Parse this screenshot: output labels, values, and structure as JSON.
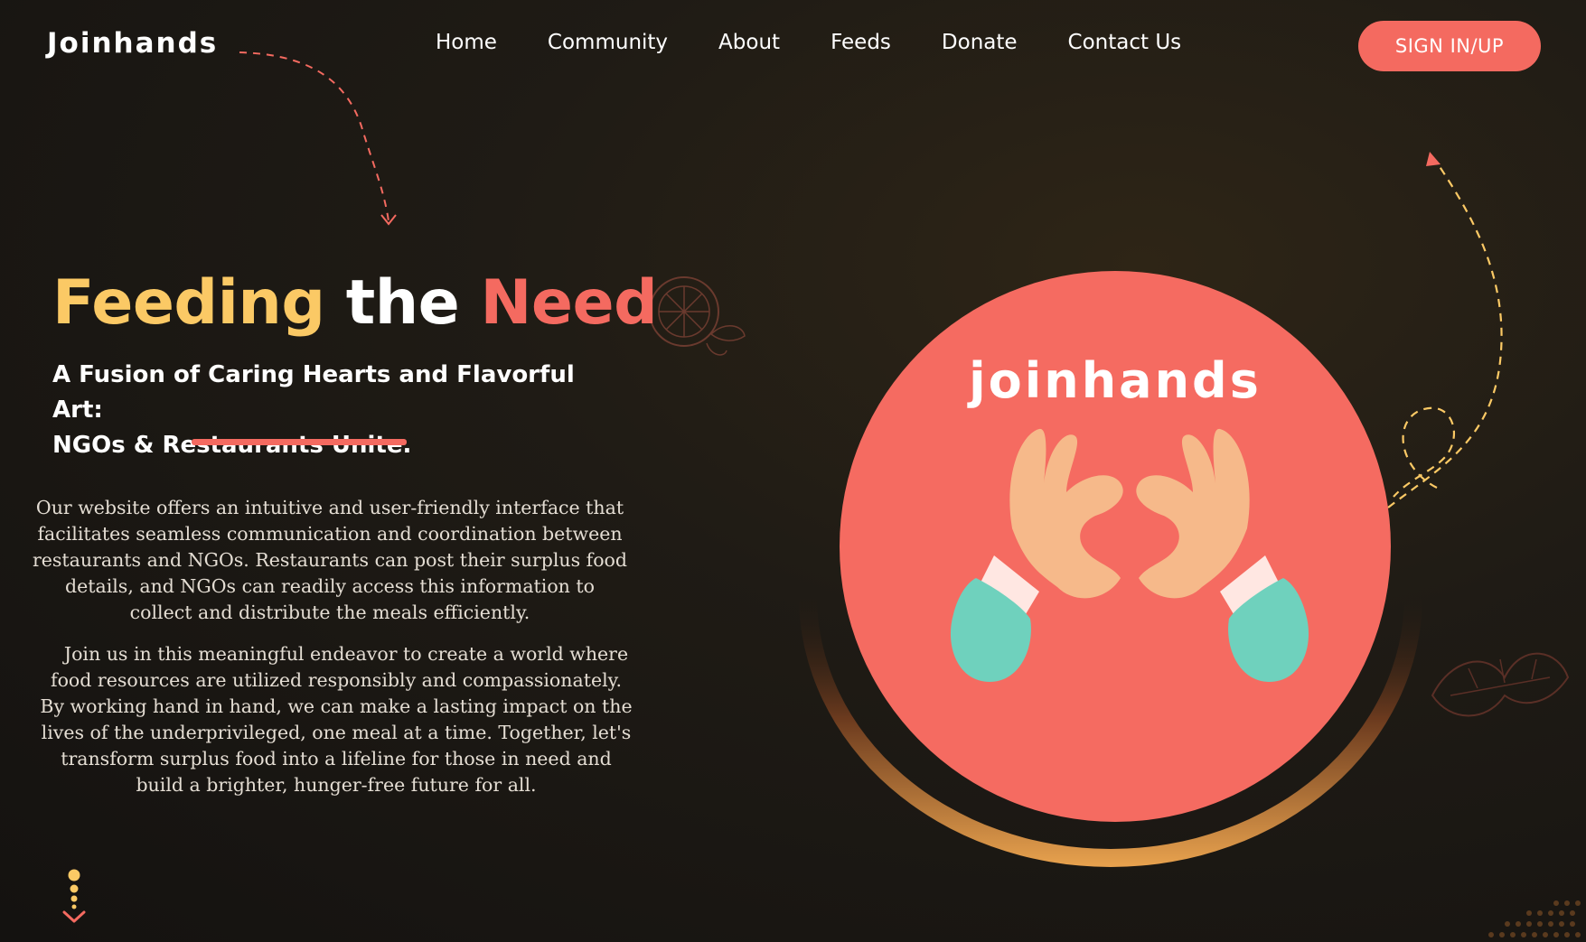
{
  "brand": {
    "logo_text": "Joinhands"
  },
  "nav": {
    "items": [
      "Home",
      "Community",
      "About",
      "Feeds",
      "Donate",
      "Contact Us"
    ],
    "signin_label": "SIGN IN/UP"
  },
  "hero": {
    "title_part1": "Feeding",
    "title_part2": "the",
    "title_part3": "Need",
    "subtitle_line1": "A Fusion of Caring Hearts and Flavorful Art:",
    "subtitle_line2": "NGOs & Restaurants Unite.",
    "paragraph1": "Our website offers an intuitive and user-friendly interface that facilitates seamless communication and coordination between restaurants and NGOs. Restaurants can post their surplus food details, and NGOs can readily access this information to collect and distribute the meals efficiently.",
    "paragraph2": "Join us in this meaningful endeavor to create a world where food resources are utilized responsibly and compassionately. By working hand in hand, we can make a lasting impact on the lives of the underprivileged, one meal at a time. Together, let's transform surplus food into a lifeline for those in need and build a brighter, hunger-free future for all."
  },
  "illustration": {
    "circle_logo_text": "joinhands",
    "icon": "heart-hands-icon"
  },
  "colors": {
    "accent_coral": "#f46a60",
    "accent_yellow": "#fbc965",
    "sleeve_teal": "#6fd1bd",
    "skin": "#f6b98a"
  }
}
